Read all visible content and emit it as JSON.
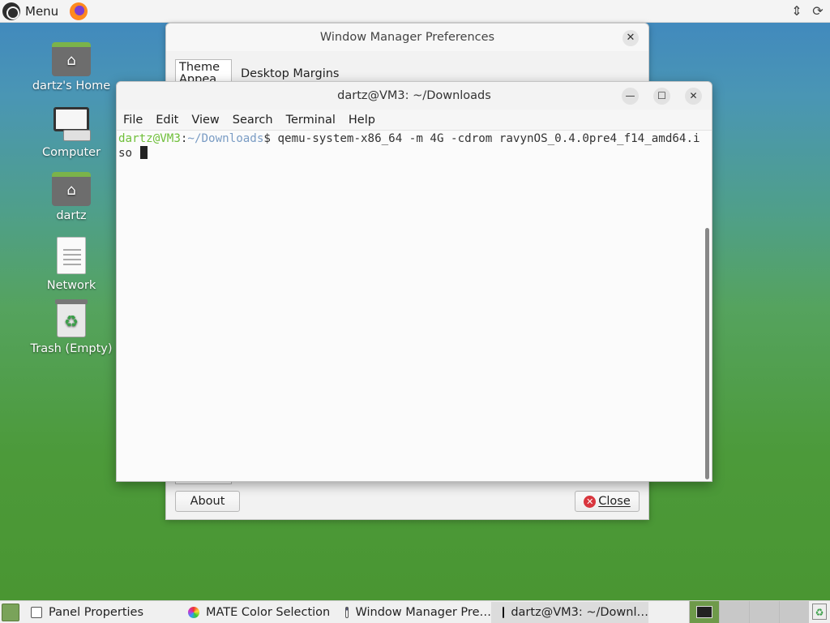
{
  "top_panel": {
    "menu_label": "Menu",
    "icons": [
      "mate-menu-icon",
      "firefox-icon",
      "network-icon",
      "update-icon"
    ]
  },
  "desktop": {
    "icons": [
      {
        "label": "dartz's Home",
        "icon": "home-folder-icon"
      },
      {
        "label": "Computer",
        "icon": "computer-icon"
      },
      {
        "label": "dartz",
        "icon": "home-folder-icon"
      },
      {
        "label": "Network",
        "icon": "network-document-icon"
      },
      {
        "label": "Trash (Empty)",
        "icon": "trash-icon"
      }
    ]
  },
  "wm_prefs": {
    "title": "Window Manager Preferences",
    "tabs": [
      "Theme\nAppea…",
      "Desktop Margins"
    ],
    "about_label": "About",
    "close_label": "Close"
  },
  "terminal": {
    "title": "dartz@VM3: ~/Downloads",
    "menu": [
      "File",
      "Edit",
      "View",
      "Search",
      "Terminal",
      "Help"
    ],
    "prompt_user": "dartz@VM3",
    "prompt_sep": ":",
    "prompt_path": "~/Downloads",
    "prompt_dollar": "$ ",
    "command": "qemu-system-x86_64 -m 4G -cdrom ravynOS_0.4.0pre4_f14_amd64.iso "
  },
  "taskbar": {
    "tasks": [
      {
        "label": "Panel Properties",
        "icon": "panel-properties-icon"
      },
      {
        "label": "MATE Color Selection",
        "icon": "color-selection-icon"
      },
      {
        "label": "Window Manager Pre…",
        "icon": "window-manager-icon"
      },
      {
        "label": "dartz@VM3: ~/Downl…",
        "icon": "terminal-icon"
      }
    ]
  }
}
